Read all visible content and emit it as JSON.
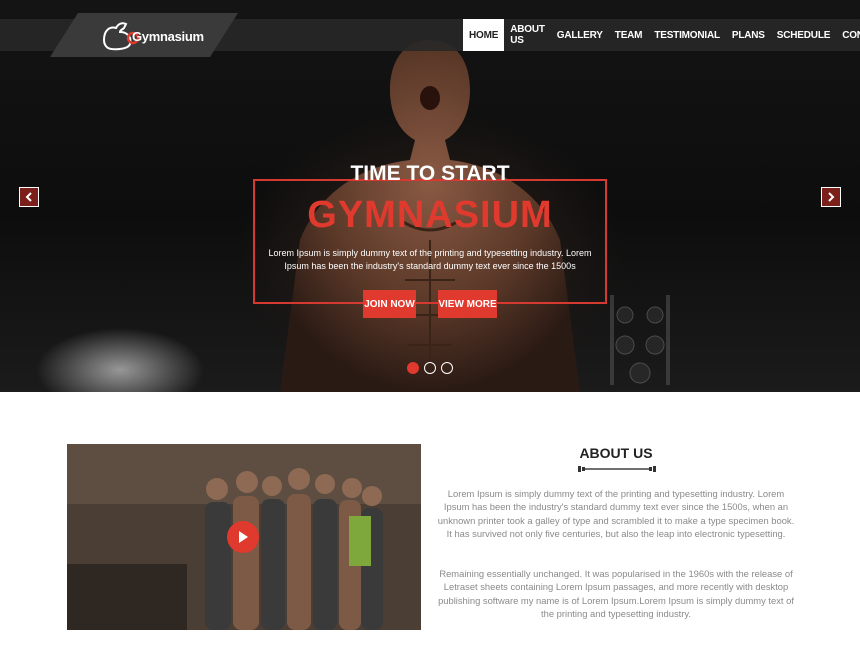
{
  "brand": {
    "logo_text": "Gymnasium"
  },
  "nav": {
    "items": [
      {
        "label": "HOME",
        "active": true
      },
      {
        "label": "ABOUT US"
      },
      {
        "label": "GALLERY"
      },
      {
        "label": "TEAM"
      },
      {
        "label": "TESTIMONIAL"
      },
      {
        "label": "PLANS"
      },
      {
        "label": "SCHEDULE"
      },
      {
        "label": "CONTACT"
      }
    ]
  },
  "hero": {
    "kicker": "TIME TO START",
    "title": "GYMNASIUM",
    "description": "Lorem Ipsum is simply dummy text of the printing and typesetting industry. Lorem Ipsum has been the industry's standard dummy text ever since the 1500s",
    "join_label": "JOIN NOW",
    "view_label": "VIEW MORE",
    "prev_icon": "chevron-left-icon",
    "next_icon": "chevron-right-icon",
    "slides": 3,
    "active_slide": 1
  },
  "about": {
    "title": "ABOUT US",
    "paragraph1": "Lorem Ipsum is simply dummy text of the printing and typesetting industry. Lorem Ipsum has been the industry's standard dummy text ever since the 1500s, when an unknown printer took a galley of type and scrambled it to make a type specimen book. It has survived not only five centuries, but also the leap into electronic typesetting.",
    "paragraph2": "Remaining essentially unchanged. It was popularised in the 1960s with the release of Letraset sheets containing Lorem Ipsum passages, and more recently with desktop publishing software my name is of Lorem Ipsum.Lorem Ipsum is simply dummy text of the printing and typesetting industry.",
    "video_icon": "play-icon",
    "divider_icon": "barbell-icon"
  },
  "colors": {
    "accent": "#e0392e",
    "dark": "#141414",
    "text_muted": "#8a8a8a"
  }
}
